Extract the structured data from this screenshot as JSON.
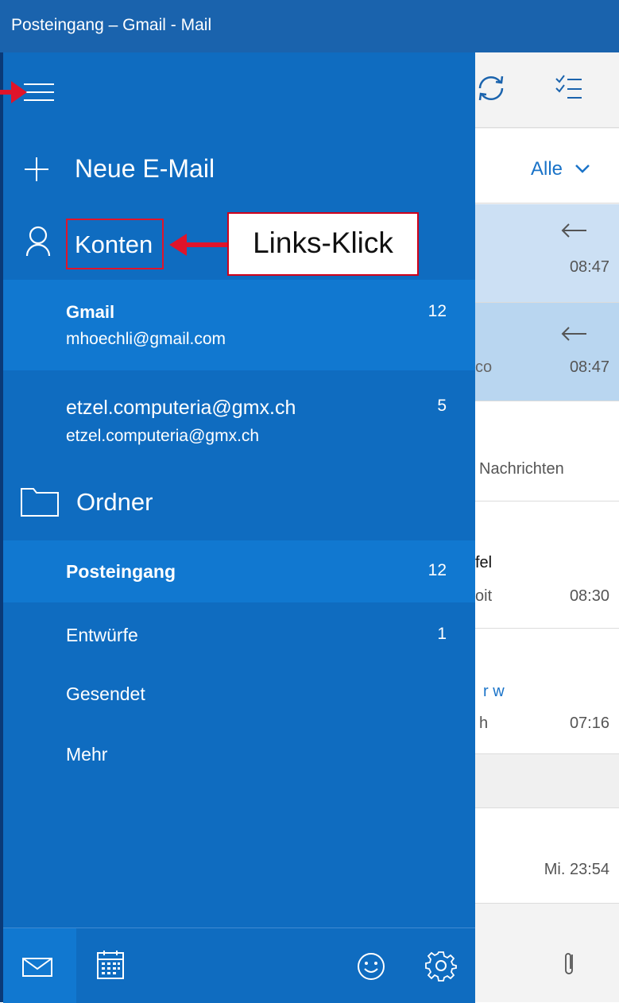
{
  "window": {
    "title": "Posteingang – Gmail - Mail"
  },
  "nav": {
    "new_mail": "Neue E-Mail",
    "accounts_header": "Konten",
    "accounts": [
      {
        "name": "Gmail",
        "email": "mhoechli@gmail.com",
        "count": "12",
        "selected": true
      },
      {
        "name": "etzel.computeria@gmx.ch",
        "email": "etzel.computeria@gmx.ch",
        "count": "5",
        "selected": false
      }
    ],
    "folders_header": "Ordner",
    "folders": [
      {
        "label": "Posteingang",
        "count": "12",
        "selected": true
      },
      {
        "label": "Entwürfe",
        "count": "1"
      },
      {
        "label": "Gesendet",
        "count": ""
      },
      {
        "label": "Mehr",
        "count": ""
      }
    ]
  },
  "annotation": {
    "callout": "Links-Klick"
  },
  "mail_list": {
    "filter": "Alle",
    "items": [
      {
        "partial_text": "",
        "time": "08:47"
      },
      {
        "partial_text": "co",
        "time": "08:47"
      },
      {
        "partial_text": "Nachrichten",
        "time": ""
      },
      {
        "partial_text": "fel",
        "partial_text2": "oit",
        "time": "08:30"
      },
      {
        "partial_text": "r w",
        "partial_text2": "h",
        "time": "07:16"
      },
      {
        "partial_text": "",
        "time": "Mi. 23:54"
      }
    ]
  },
  "footer": {
    "icons": [
      "mail-icon",
      "calendar-icon",
      "smiley-icon",
      "settings-icon"
    ]
  },
  "colors": {
    "titlebar": "#1a63ad",
    "nav": "#0f6cc0",
    "highlight": "#1178d0",
    "annotation": "#e0142a",
    "accent": "#1a73c8"
  }
}
